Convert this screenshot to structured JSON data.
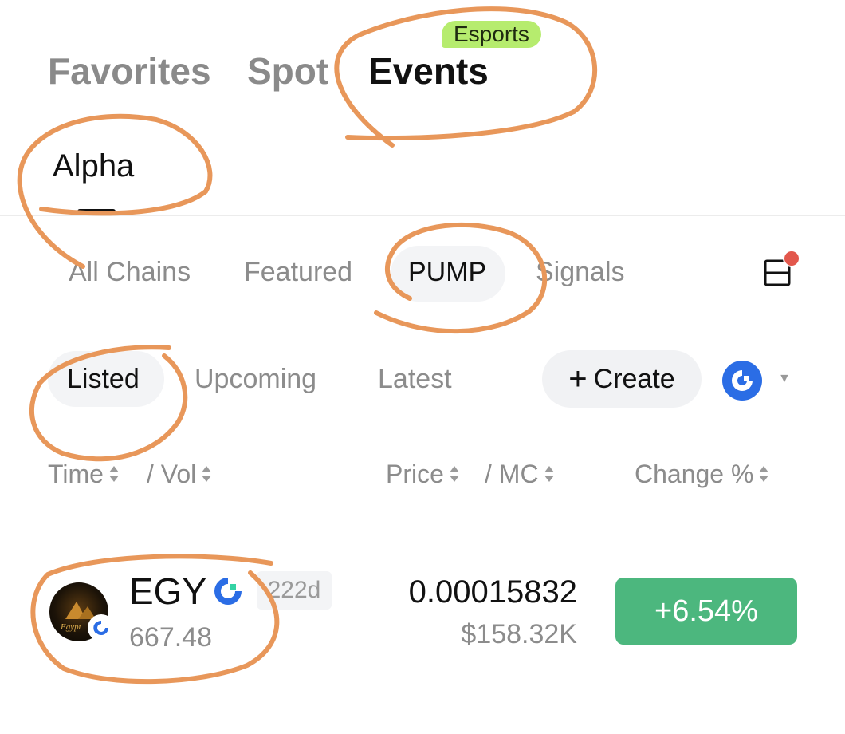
{
  "top_tabs": [
    {
      "label": "Favorites"
    },
    {
      "label": "Spot"
    },
    {
      "label": "Events",
      "badge": "Esports"
    }
  ],
  "sub_tab": {
    "label": "Alpha"
  },
  "chain_filter": [
    "All Chains",
    "Featured",
    "PUMP",
    "Signals"
  ],
  "listing_tabs": [
    "Listed",
    "Upcoming",
    "Latest"
  ],
  "create_button": {
    "label": "Create"
  },
  "column_headers": {
    "time": "Time",
    "vol": "/ Vol",
    "price": "Price",
    "mc": "/ MC",
    "change": "Change %"
  },
  "token": {
    "symbol": "EGY",
    "age": "222d",
    "volume": "667.48",
    "price": "0.00015832",
    "market_cap": "$158.32K",
    "change": "+6.54%",
    "avatar_text": "Egypt"
  },
  "colors": {
    "accent_green": "#4cb77e",
    "esports_badge": "#b6ec6e",
    "chain_blue": "#2b6de5",
    "annotation_orange": "#e8975a",
    "notification_dot": "#e2574c"
  }
}
